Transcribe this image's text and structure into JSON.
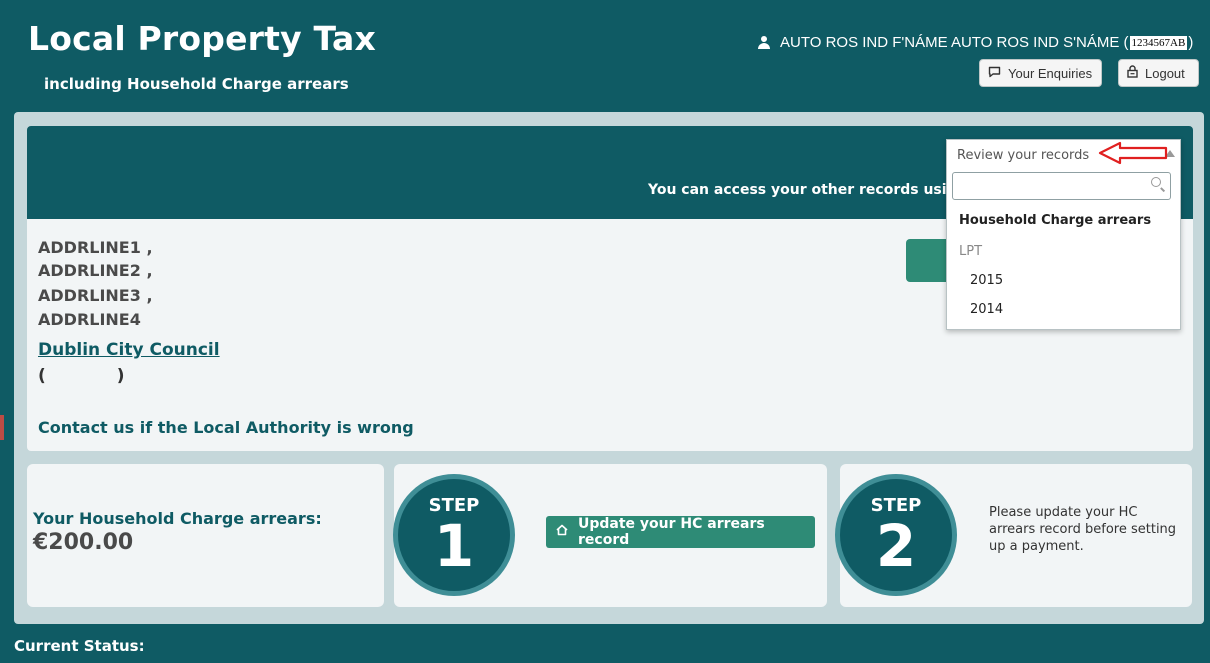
{
  "header": {
    "title": "Local Property Tax",
    "subtitle": "including Household Charge arrears",
    "user_name": "AUTO ROS IND F'NÁME AUTO ROS IND S'NÁME (",
    "user_ref": "1234567AB",
    "user_close": ")",
    "enquiries_label": "Your Enquiries",
    "logout_label": "Logout"
  },
  "banner": {
    "text": "You can access your other records using the"
  },
  "property": {
    "address_lines": [
      "ADDRLINE1 ,",
      "ADDRLINE2 ,",
      "ADDRLINE3 ,",
      "ADDRLINE4"
    ],
    "council": "Dublin City Council",
    "paren_text": "(            )",
    "contact_link": "Contact us if the Local Authority is wrong"
  },
  "records_dropdown": {
    "header": "Review your records",
    "search_value": "",
    "items": [
      {
        "label": "Household Charge arrears",
        "type": "item"
      },
      {
        "label": "LPT",
        "type": "group"
      },
      {
        "label": "2015",
        "type": "subitem"
      },
      {
        "label": "2014",
        "type": "subitem"
      }
    ]
  },
  "arrears": {
    "label": "Your Household Charge arrears:",
    "value": "€200.00"
  },
  "steps": {
    "step_label": "STEP",
    "step1_number": "1",
    "step2_number": "2",
    "update_button": "Update your HC arrears record",
    "step2_text": "Please update your HC arrears record before setting up a payment."
  },
  "footer": {
    "current_status": "Current Status:"
  },
  "colors": {
    "brand_teal": "#0f5b64",
    "button_green": "#2e8b76",
    "annotation_red": "#e02020"
  }
}
